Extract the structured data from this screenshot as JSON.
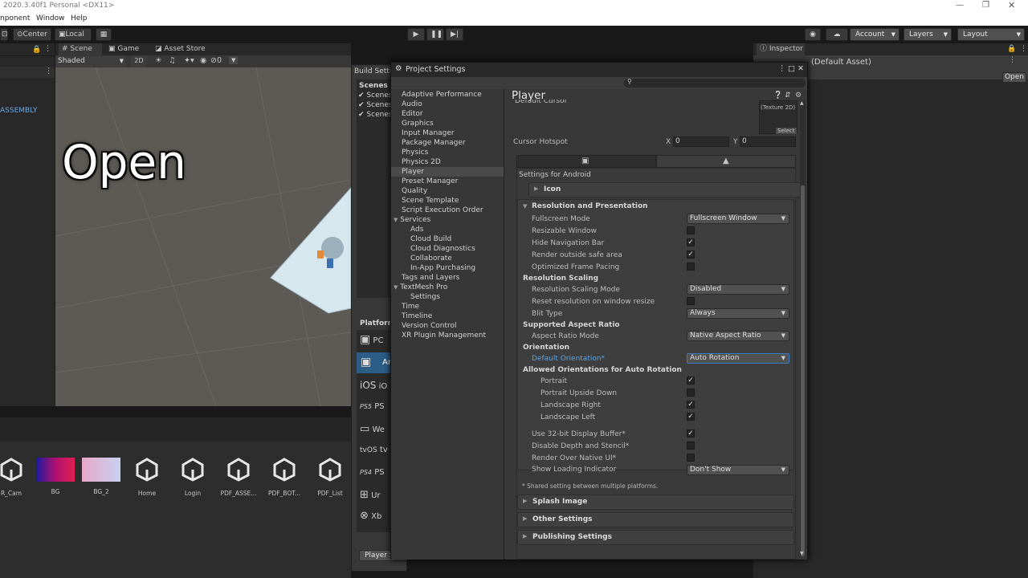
{
  "window": {
    "title": "2020.3.40f1 Personal <DX11>",
    "menus": [
      "nponent",
      "Window",
      "Help"
    ]
  },
  "toolbar": {
    "center": "Center",
    "local": "Local",
    "account": "Account",
    "layers": "Layers",
    "layout": "Layout"
  },
  "scene": {
    "tabs": [
      "Scene",
      "Game",
      "Asset Store"
    ],
    "shading": "Shaded",
    "mode_2d": "2D",
    "gizmo_count": "0",
    "overlay_text": "Open"
  },
  "hierarchy": {
    "item": "ASSEMBLY"
  },
  "inspector": {
    "tab": "Inspector",
    "asset": "(Default Asset)",
    "open_button": "Open"
  },
  "project": {
    "assets": [
      "R_Cam",
      "BG",
      "BG_2",
      "Home",
      "Login",
      "PDF_ASSE...",
      "PDF_BOT...",
      "PDF_List"
    ]
  },
  "build": {
    "title": "Build Setti",
    "scenes_header": "Scenes I",
    "scenes": [
      "Scenes",
      "Scenes",
      "Scenes"
    ],
    "platform_header": "Platform",
    "platforms": [
      "PC",
      "Ar",
      "iO",
      "PS",
      "We",
      "tv",
      "PS",
      "Ur",
      "Xb"
    ],
    "platform_icon_text": {
      "ios": "iOS",
      "ps5": "PS5",
      "tvos": "tvOS",
      "ps4": "PS4"
    },
    "player_settings_button": "Player S"
  },
  "project_settings": {
    "title": "Project Settings",
    "nav": [
      "Adaptive Performance",
      "Audio",
      "Editor",
      "Graphics",
      "Input Manager",
      "Package Manager",
      "Physics",
      "Physics 2D",
      "Player",
      "Preset Manager",
      "Quality",
      "Scene Template",
      "Script Execution Order",
      "Services",
      "Ads",
      "Cloud Build",
      "Cloud Diagnostics",
      "Collaborate",
      "In-App Purchasing",
      "Tags and Layers",
      "TextMesh Pro",
      "Settings",
      "Time",
      "Timeline",
      "Version Control",
      "XR Plugin Management"
    ],
    "player": {
      "title": "Player",
      "default_cursor": "Default Cursor",
      "texture_label": "(Texture 2D)",
      "select": "Select",
      "cursor_hotspot": "Cursor Hotspot",
      "x_label": "X",
      "x_value": "0",
      "y_label": "Y",
      "y_value": "0",
      "settings_for": "Settings for Android",
      "icon_section": "Icon",
      "resolution_section": "Resolution and Presentation",
      "fullscreen_mode": {
        "label": "Fullscreen Mode",
        "value": "Fullscreen Window"
      },
      "resizable_window": {
        "label": "Resizable Window",
        "checked": false
      },
      "hide_navigation_bar": {
        "label": "Hide Navigation Bar",
        "checked": true
      },
      "render_outside_safe_area": {
        "label": "Render outside safe area",
        "checked": true
      },
      "optimized_frame_pacing": {
        "label": "Optimized Frame Pacing",
        "checked": false
      },
      "resolution_scaling": "Resolution Scaling",
      "resolution_scaling_mode": {
        "label": "Resolution Scaling Mode",
        "value": "Disabled"
      },
      "reset_resolution": {
        "label": "Reset resolution on window resize",
        "checked": false
      },
      "blit_type": {
        "label": "Blit Type",
        "value": "Always"
      },
      "supported_aspect_ratio": "Supported Aspect Ratio",
      "aspect_ratio_mode": {
        "label": "Aspect Ratio Mode",
        "value": "Native Aspect Ratio"
      },
      "orientation": "Orientation",
      "default_orientation": {
        "label": "Default Orientation*",
        "value": "Auto Rotation"
      },
      "allowed_orientations": "Allowed Orientations for Auto Rotation",
      "portrait": {
        "label": "Portrait",
        "checked": true
      },
      "portrait_upside_down": {
        "label": "Portrait Upside Down",
        "checked": false
      },
      "landscape_right": {
        "label": "Landscape Right",
        "checked": true
      },
      "landscape_left": {
        "label": "Landscape Left",
        "checked": true
      },
      "use_32bit_buffer": {
        "label": "Use 32-bit Display Buffer*",
        "checked": true
      },
      "disable_depth_stencil": {
        "label": "Disable Depth and Stencil*",
        "checked": false
      },
      "render_over_native_ui": {
        "label": "Render Over Native UI*",
        "checked": false
      },
      "show_loading_indicator": {
        "label": "Show Loading Indicator",
        "value": "Don't Show"
      },
      "shared_note": "* Shared setting between multiple platforms.",
      "splash_image": "Splash Image",
      "other_settings": "Other Settings",
      "publishing_settings": "Publishing Settings"
    }
  },
  "colors": {
    "accent_label": "#5ba3e8",
    "selection": "#4a4a4a"
  }
}
